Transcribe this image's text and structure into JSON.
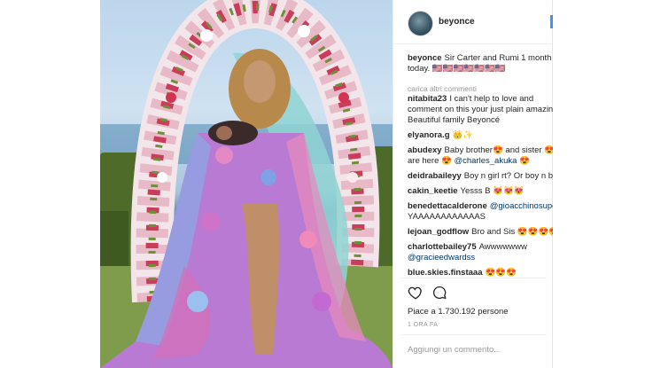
{
  "post": {
    "username": "beyonce",
    "caption_user": "beyonce",
    "caption_text": "Sir Carter and Rumi 1 month today. 🇺🇸🇺🇸🇺🇸🇺🇸🇺🇸🇺🇸🇺🇸",
    "load_more": "carica altri commenti",
    "comments": [
      {
        "user": "nitabita23",
        "text": "I can't help to love and comment on this your just plain amazing Beautiful family Beyoncé"
      },
      {
        "user": "elyanora.g",
        "text": "👑✨"
      },
      {
        "user": "abudexy",
        "text": "Baby brother😍 and sister 😍 are here 😍",
        "mention": "@charles_akuka",
        "after": "😍"
      },
      {
        "user": "deidrabaileyy",
        "text": "Boy n girl rt? Or boy n boy"
      },
      {
        "user": "cakin_keetie",
        "text": "Yesss B 😻😻😻"
      },
      {
        "user": "benedettacalderone",
        "mention": "@gioacchinosuperman",
        "text": "YAAAAAAAAAAAAS"
      },
      {
        "user": "lejoan_godflow",
        "text": "Bro and Sis 😍😍😍😍"
      },
      {
        "user": "charlottebailey75",
        "text": "Awwwwwww",
        "mention": "@gracieedwardss"
      },
      {
        "user": "blue.skies.finstaaa",
        "text": "😍😍😍"
      }
    ],
    "likes_text": "Piace a 1.730.192 persone",
    "time_text": "1 ORA FA",
    "add_comment_placeholder": "Aggiungi un commento..."
  },
  "icons": {
    "like": "heart-outline-icon",
    "comment": "speech-bubble-icon"
  },
  "colors": {
    "text": "#262626",
    "muted": "#999999",
    "mention": "#003569",
    "follow_button": "#3897f0"
  }
}
